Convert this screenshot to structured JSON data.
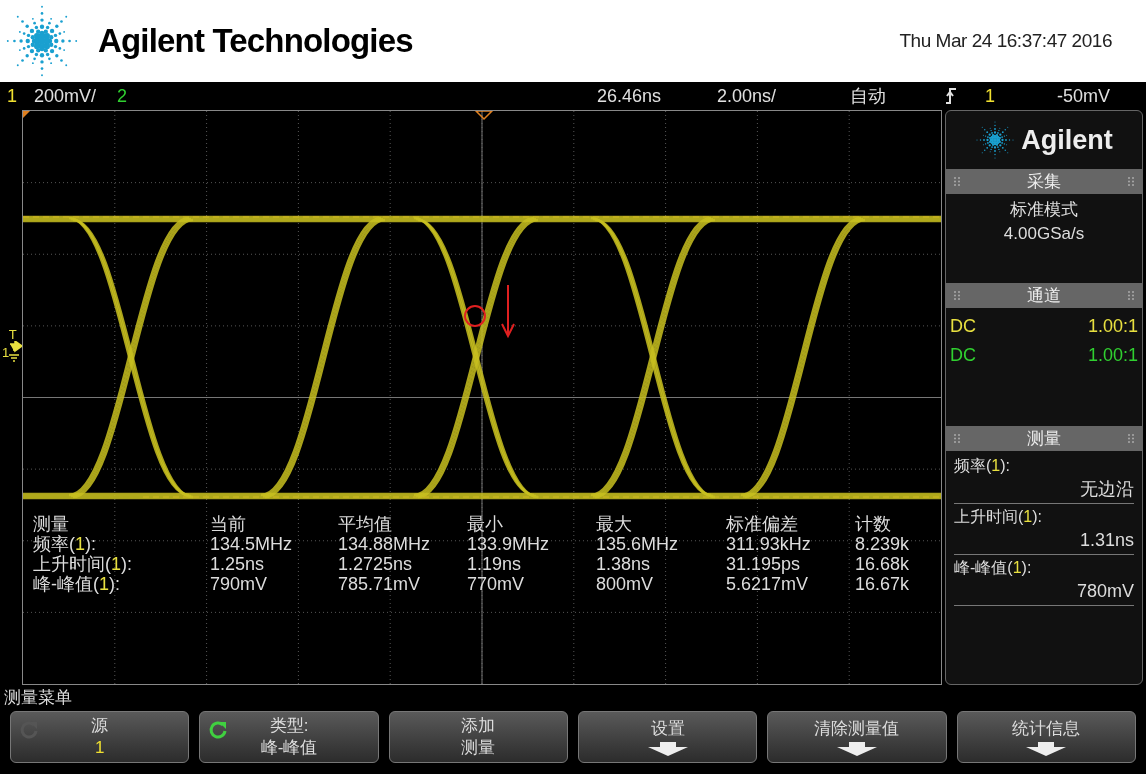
{
  "header": {
    "brand": "Agilent Technologies",
    "datetime": "Thu Mar 24 16:37:47 2016"
  },
  "status_bar": [
    {
      "kind": "text",
      "text": "1",
      "color": "#f0e030"
    },
    {
      "kind": "text",
      "text": "200mV/",
      "color": "#e0e0e0"
    },
    {
      "kind": "text",
      "text": "2",
      "color": "#30d030"
    },
    {
      "kind": "text",
      "text": "26.46ns",
      "color": "#e0e0e0"
    },
    {
      "kind": "text",
      "text": "2.00ns/",
      "color": "#e0e0e0"
    },
    {
      "kind": "text",
      "text": "自动",
      "color": "#e0e0e0"
    },
    {
      "kind": "edge-icon",
      "color": "#e0e0e0"
    },
    {
      "kind": "text",
      "text": "1",
      "color": "#f0e030"
    },
    {
      "kind": "text",
      "text": "-50mV",
      "color": "#e0e0e0"
    }
  ],
  "graticule": {
    "channel_marker": "1",
    "trigger_marker": "T",
    "stats": {
      "corner_label": "测量",
      "columns": [
        "当前",
        "平均值",
        "最小",
        "最大",
        "标准偏差",
        "计数"
      ],
      "rows": [
        {
          "label_before": "频率(",
          "source": "1",
          "label_after": "):",
          "cells": [
            "134.5MHz",
            "134.88MHz",
            "133.9MHz",
            "135.6MHz",
            "311.93kHz",
            "8.239k"
          ]
        },
        {
          "label_before": "上升时间(",
          "source": "1",
          "label_after": "):",
          "cells": [
            "1.25ns",
            "1.2725ns",
            "1.19ns",
            "1.38ns",
            "31.195ps",
            "16.68k"
          ]
        },
        {
          "label_before": "峰-峰值(",
          "source": "1",
          "label_after": "):",
          "cells": [
            "790mV",
            "785.71mV",
            "770mV",
            "800mV",
            "5.6217mV",
            "16.67k"
          ]
        }
      ]
    }
  },
  "sidebar": {
    "logo": "Agilent",
    "sections": [
      {
        "kind": "acquisition",
        "title": "采集",
        "lines": [
          "标准模式",
          "4.00GSa/s"
        ]
      },
      {
        "kind": "channels",
        "title": "通道",
        "channels": [
          {
            "coupling": "DC",
            "ratio": "1.00:1",
            "color": "#e8e040"
          },
          {
            "coupling": "DC",
            "ratio": "1.00:1",
            "color": "#30d030"
          }
        ]
      },
      {
        "kind": "measurements",
        "title": "测量",
        "measurements": [
          {
            "label_before": "频率(",
            "source": "1",
            "label_after": "):",
            "value": "无边沿"
          },
          {
            "label_before": "上升时间(",
            "source": "1",
            "label_after": "):",
            "value": "1.31ns"
          },
          {
            "label_before": "峰-峰值(",
            "source": "1",
            "label_after": "):",
            "value": "780mV"
          }
        ]
      }
    ]
  },
  "menu": {
    "title": "测量菜单",
    "softkeys": [
      {
        "kind": "channel-value",
        "title": "源",
        "value": "1",
        "knob_active": false
      },
      {
        "kind": "value",
        "title": "类型:",
        "value": "峰-峰值",
        "knob_active": true
      },
      {
        "kind": "value",
        "title": "添加",
        "value": "测量"
      },
      {
        "kind": "arrow",
        "title": "设置"
      },
      {
        "kind": "arrow",
        "title": "清除测量值"
      },
      {
        "kind": "arrow",
        "title": "统计信息"
      }
    ]
  }
}
